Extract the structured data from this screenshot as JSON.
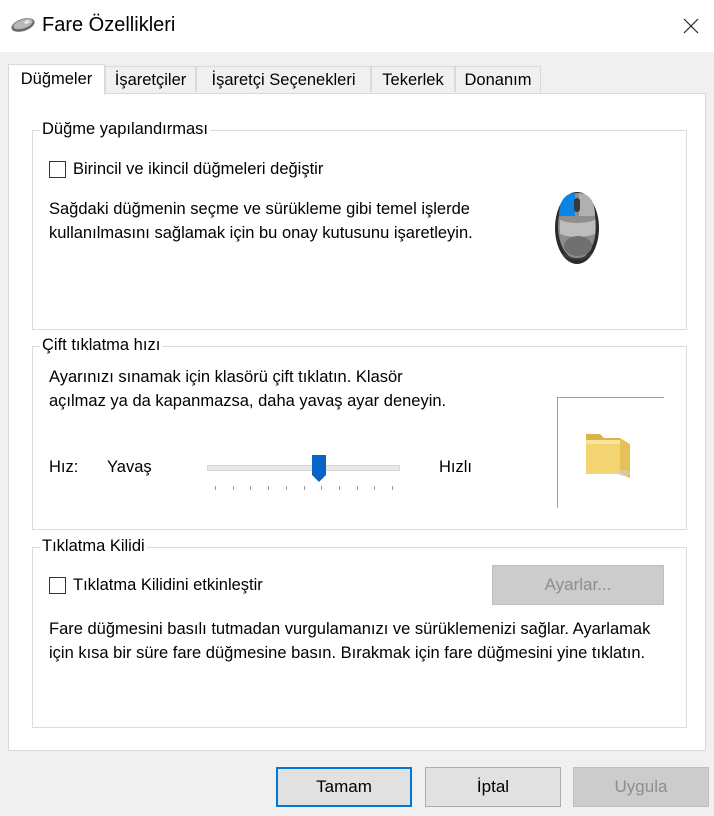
{
  "window": {
    "title": "Fare Özellikleri"
  },
  "tabs": [
    {
      "label": "Düğmeler"
    },
    {
      "label": "İşaretçiler"
    },
    {
      "label": "İşaretçi Seçenekleri"
    },
    {
      "label": "Tekerlek"
    },
    {
      "label": "Donanım"
    }
  ],
  "button_config": {
    "legend": "Düğme yapılandırması",
    "swap_label": "Birincil ve ikincil düğmeleri değiştir",
    "swap_checked": false,
    "description": "Sağdaki düğmenin seçme ve sürükleme gibi temel işlerde kullanılmasını sağlamak için bu onay kutusunu işaretleyin."
  },
  "double_click": {
    "legend": "Çift tıklatma hızı",
    "description": "Ayarınızı sınamak için klasörü çift tıklatın. Klasör açılmaz ya da kapanmazsa, daha yavaş ayar deneyin.",
    "speed_label": "Hız:",
    "slow_label": "Yavaş",
    "fast_label": "Hızlı",
    "speed_value": 0.59
  },
  "click_lock": {
    "legend": "Tıklatma Kilidi",
    "enable_label": "Tıklatma Kilidini etkinleştir",
    "enable_checked": false,
    "settings_label": "Ayarlar...",
    "description": "Fare düğmesini basılı tutmadan vurgulamanızı ve sürüklemenizi sağlar. Ayarlamak için kısa bir süre fare düğmesine basın.  Bırakmak için fare düğmesini yine tıklatın."
  },
  "footer": {
    "ok_label": "Tamam",
    "cancel_label": "İptal",
    "apply_label": "Uygula"
  },
  "colors": {
    "accent": "#0078d7",
    "slider_thumb": "#0a64c8",
    "disabled_text": "#8d8d8d"
  },
  "icons": [
    "mouse-icon",
    "close-icon",
    "mouse-illustration",
    "folder-icon"
  ]
}
